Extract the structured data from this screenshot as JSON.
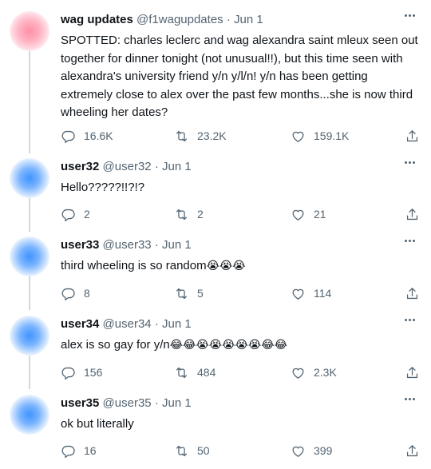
{
  "tweets": [
    {
      "name": "wag updates",
      "handle": "@f1wagupdates",
      "sep": "·",
      "date": "Jun 1",
      "text": "SPOTTED: charles leclerc and wag alexandra saint mleux seen out together for dinner tonight (not unusual!!), but this time seen with alexandra's university friend y/n y/l/n! y/n has been getting extremely close to alex over the past few months...she is now third wheeling her dates?",
      "emojis": "",
      "replies": "16.6K",
      "retweets": "23.2K",
      "likes": "159.1K",
      "avatar_color": "#ff9db3"
    },
    {
      "name": "user32",
      "handle": "@user32",
      "sep": "·",
      "date": "Jun 1",
      "text": "Hello?????!!?!?",
      "emojis": "",
      "replies": "2",
      "retweets": "2",
      "likes": "21",
      "avatar_color": "#4a9bff"
    },
    {
      "name": "user33",
      "handle": "@user33",
      "sep": "·",
      "date": "Jun 1",
      "text": "third wheeling is so random",
      "emojis": "😭😭😭",
      "replies": "8",
      "retweets": "5",
      "likes": "114",
      "avatar_color": "#4a9bff"
    },
    {
      "name": "user34",
      "handle": "@user34",
      "sep": "·",
      "date": "Jun 1",
      "text": "alex is so gay for y/n",
      "emojis": "😂😂😭😭😭😭😭😂😂",
      "replies": "156",
      "retweets": "484",
      "likes": "2.3K",
      "avatar_color": "#4a9bff"
    },
    {
      "name": "user35",
      "handle": "@user35",
      "sep": "·",
      "date": "Jun 1",
      "text": "ok but literally",
      "emojis": "",
      "replies": "16",
      "retweets": "50",
      "likes": "399",
      "avatar_color": "#4a9bff"
    }
  ],
  "icons": {
    "reply": "reply-icon",
    "retweet": "retweet-icon",
    "like": "heart-icon",
    "share": "share-icon",
    "more": "more-icon"
  },
  "colors": {
    "text": "#0f1419",
    "secondary": "#536471",
    "thread_line": "#cfd9de"
  }
}
